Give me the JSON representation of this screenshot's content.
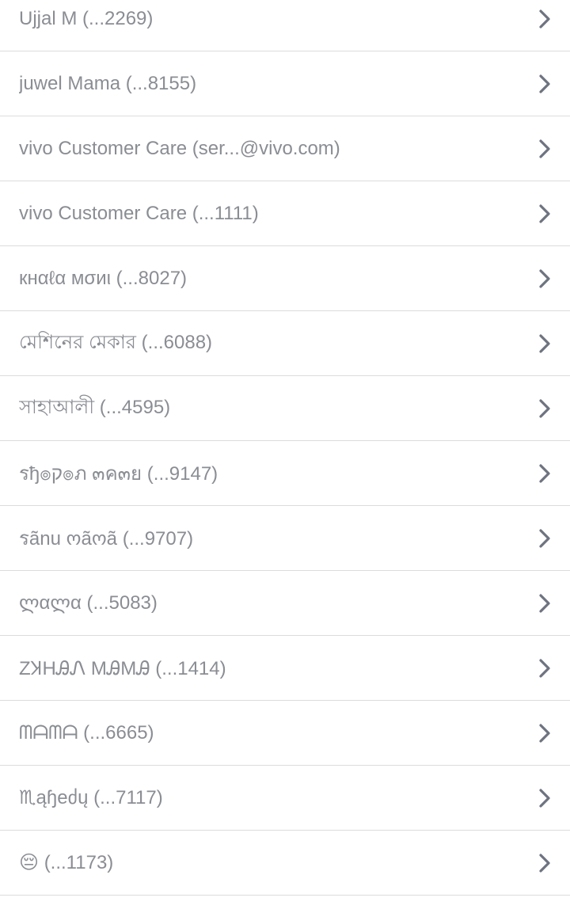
{
  "contacts": [
    {
      "label": "Ujjal M (...2269)"
    },
    {
      "label": "juwel Mama (...8155)"
    },
    {
      "label": "vivo Customer Care (ser...@vivo.com)"
    },
    {
      "label": "vivo Customer Care (...1111)"
    },
    {
      "label": "кнαℓα мσиι (...8027)"
    },
    {
      "label": "মেশিনের মেকার (...6088)"
    },
    {
      "label": "সাহাআলী (...4595)"
    },
    {
      "label": "รђ๏ק๏ภ ๓ค๓ย (...9147)"
    },
    {
      "label": "รãnu ოãოã (...9707)"
    },
    {
      "label": "ლαლα (...5083)"
    },
    {
      "label": "ZꞰHᎯᏁ MᎯMᎯ (...1414)"
    },
    {
      "label": "ᗰᗩᗰᗩ (...6665)"
    },
    {
      "label": "♏ąɧeძų (...7117)"
    },
    {
      "label": "😔 (...1173)"
    }
  ],
  "colors": {
    "text": "#8a8d93",
    "chevron": "#6e7380",
    "divider": "#dcdcdc",
    "background": "#ffffff"
  },
  "icons": {
    "row_trailing": "chevron-right-icon"
  }
}
